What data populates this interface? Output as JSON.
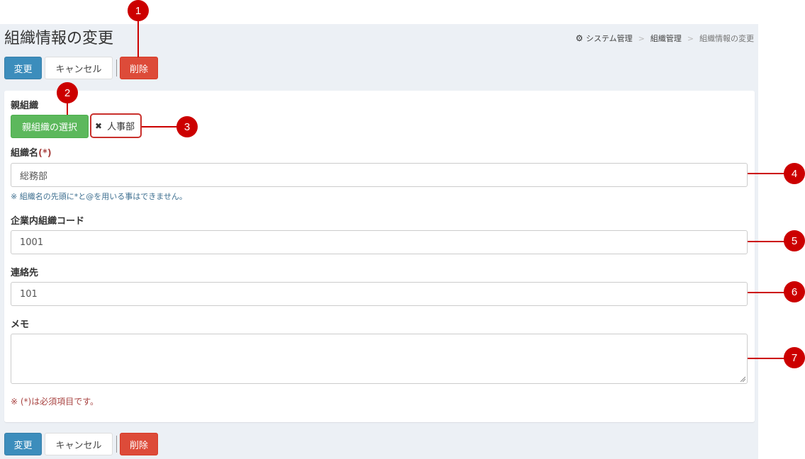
{
  "page": {
    "title": "組織情報の変更"
  },
  "breadcrumb": {
    "root": "システム管理",
    "level1": "組織管理",
    "current": "組織情報の変更"
  },
  "toolbar": {
    "change": "変更",
    "cancel": "キャンセル",
    "delete": "削除"
  },
  "form": {
    "parent_org": {
      "label": "親組織",
      "select_button": "親組織の選択",
      "selected_tag": "人事部"
    },
    "org_name": {
      "label": "組織名",
      "required_mark": "(*)",
      "value": "総務部",
      "help": "※ 組織名の先頭に*と@を用いる事はできません。"
    },
    "org_code": {
      "label": "企業内組織コード",
      "value": "1001"
    },
    "contact": {
      "label": "連絡先",
      "value": "101"
    },
    "memo": {
      "label": "メモ",
      "value": ""
    },
    "required_note": "※ (*)は必須項目です。"
  },
  "callouts": [
    "1",
    "2",
    "3",
    "4",
    "5",
    "6",
    "7"
  ]
}
